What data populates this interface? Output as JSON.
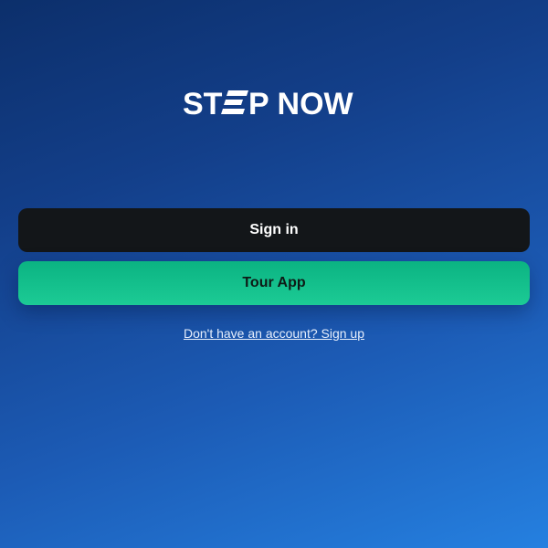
{
  "brand": {
    "logo_text": "STEP NOW",
    "logo_color": "#ffffff"
  },
  "actions": {
    "signin_label": "Sign in",
    "tour_label": "Tour App",
    "signup_link_text": "Don't have an account? Sign up"
  },
  "colors": {
    "background_top": "#0c2f6b",
    "background_bottom": "#2580e0",
    "signin_button": "#131619",
    "tour_button": "#14c08c"
  },
  "icons": {
    "logo": "step-now-logo"
  }
}
